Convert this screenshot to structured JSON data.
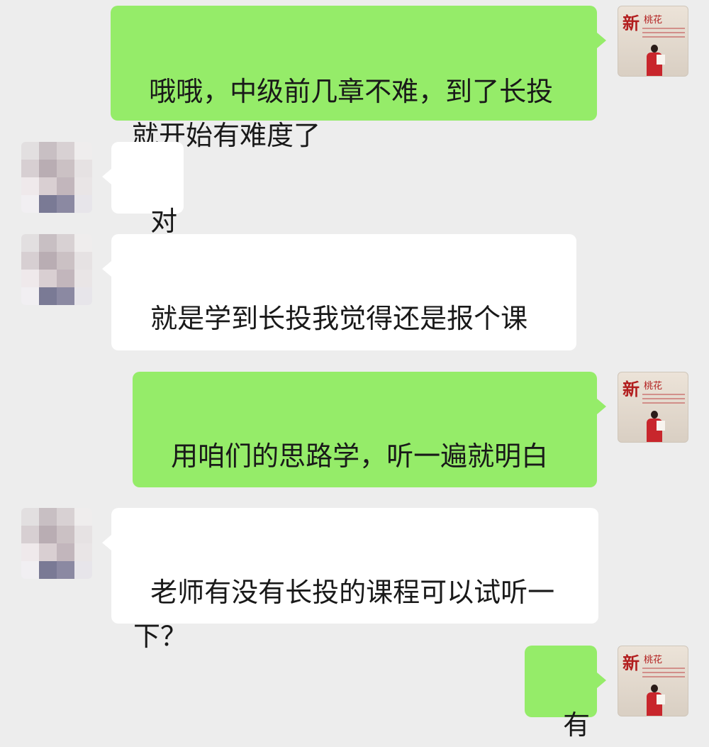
{
  "messages": [
    {
      "side": "out",
      "text": "哦哦，中级前几章不难，到了长投\n就开始有难度了"
    },
    {
      "side": "in",
      "text": "对"
    },
    {
      "side": "in",
      "text": "就是学到长投我觉得还是报个课",
      "emoji": "face-palm-crying-emoji"
    },
    {
      "side": "out",
      "text": "用咱们的思路学，听一遍就明白",
      "emoji": "hand-over-mouth-emoji"
    },
    {
      "side": "in",
      "text": "老师有没有长投的课程可以试听一\n下？"
    },
    {
      "side": "out",
      "text": "有"
    }
  ],
  "avatars": {
    "me": {
      "calligraphy": "新",
      "calligraphy_small": "桃花"
    }
  },
  "colors": {
    "background": "#ededed",
    "outgoing_bubble": "#95ec69",
    "incoming_bubble": "#ffffff",
    "text": "#191919"
  }
}
